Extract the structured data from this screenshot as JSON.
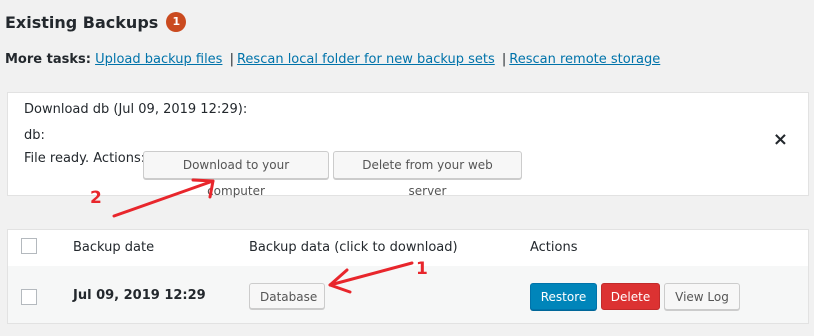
{
  "header": {
    "title": "Existing Backups",
    "badge_count": "1"
  },
  "more_tasks": {
    "label": "More tasks:",
    "links": [
      "Upload backup files",
      "Rescan local folder for new backup sets",
      "Rescan remote storage"
    ],
    "separator": "|"
  },
  "download_panel": {
    "heading": "Download db (Jul 09, 2019 12:29):",
    "entity": "db:",
    "status": "File ready. Actions:",
    "download_button": "Download to your computer",
    "delete_button": "Delete from your web server",
    "close_glyph": "×"
  },
  "table": {
    "columns": [
      "Backup date",
      "Backup data (click to download)",
      "Actions"
    ],
    "rows": [
      {
        "date": "Jul 09, 2019 12:29",
        "data_button": "Database",
        "actions": [
          "Restore",
          "Delete",
          "View Log"
        ]
      }
    ]
  },
  "annotations": {
    "labels": [
      "1",
      "2"
    ],
    "color": "#e8262c"
  },
  "colors": {
    "badge": "#ca4a1f",
    "link": "#0073aa",
    "restore": "#0085ba",
    "delete": "#dc3232"
  }
}
